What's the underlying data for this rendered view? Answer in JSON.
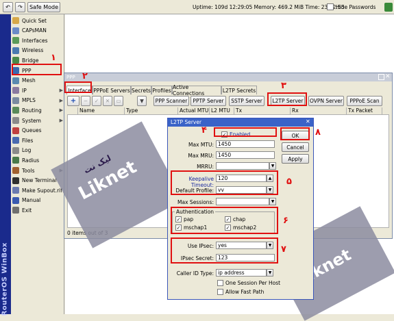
{
  "topbar": {
    "undo": "↶",
    "redo": "↷",
    "safe_mode": "Safe Mode",
    "uptime_label": "Uptime:",
    "uptime_value": "109d 12:29:05",
    "memory_label": "Memory:",
    "memory_value": "469.2 MiB",
    "time_label": "Time:",
    "time_value": "23:12:55",
    "hide_passwords": "Hide Passwords"
  },
  "vertical_brand": "RouterOS WinBox",
  "sidebar": {
    "items": [
      {
        "label": "Quick Set",
        "color": "#d6a84a"
      },
      {
        "label": "CAPsMAN",
        "color": "#6a8ac8"
      },
      {
        "label": "Interfaces",
        "color": "#5a9a5a"
      },
      {
        "label": "Wireless",
        "color": "#4a7ab0"
      },
      {
        "label": "Bridge",
        "color": "#4a8a4a"
      },
      {
        "label": "PPP",
        "color": "#3a6ab0"
      },
      {
        "label": "Mesh",
        "color": "#5a8ab0"
      },
      {
        "label": "IP",
        "color": "#8a7aa0",
        "arrow": "▶"
      },
      {
        "label": "MPLS",
        "color": "#7a8aa0",
        "arrow": "▶"
      },
      {
        "label": "Routing",
        "color": "#5a8a5a",
        "arrow": "▶"
      },
      {
        "label": "System",
        "color": "#8a8a8a",
        "arrow": "▶"
      },
      {
        "label": "Queues",
        "color": "#c04040"
      },
      {
        "label": "Files",
        "color": "#4a6ab0"
      },
      {
        "label": "Log",
        "color": "#8a8a8a"
      },
      {
        "label": "Radius",
        "color": "#4a7a4a"
      },
      {
        "label": "Tools",
        "color": "#a06030",
        "arrow": "▶"
      },
      {
        "label": "New Terminal",
        "color": "#303030"
      },
      {
        "label": "Make Supout.rif",
        "color": "#6a7ab0"
      },
      {
        "label": "Manual",
        "color": "#3a5ab0"
      },
      {
        "label": "Exit",
        "color": "#707070"
      }
    ]
  },
  "ppp_window": {
    "title": "PPP",
    "tabs": [
      "Interface",
      "PPPoE Servers",
      "Secrets",
      "Profiles",
      "Active Connections",
      "L2TP Secrets"
    ],
    "toolbar_buttons": [
      "PPP Scanner",
      "PPTP Server",
      "SSTP Server",
      "L2TP Server",
      "OVPN Server",
      "PPPoE Scan"
    ],
    "columns": [
      "Name",
      "Type",
      "Actual MTU",
      "L2 MTU",
      "Tx",
      "Rx",
      "Tx Packet (p/s)"
    ],
    "status": "0 items out of 3"
  },
  "l2tp_dialog": {
    "title": "L2TP Server",
    "enabled_label": "Enabled",
    "max_mtu_label": "Max MTU:",
    "max_mtu": "1450",
    "max_mru_label": "Max MRU:",
    "max_mru": "1450",
    "mrru_label": "MRRU:",
    "keepalive_label": "Keepalive Timeout:",
    "keepalive": "120",
    "default_profile_label": "Default Profile:",
    "default_profile": "vv",
    "max_sessions_label": "Max Sessions:",
    "auth_title": "Authentication",
    "auth": {
      "pap": "pap",
      "chap": "chap",
      "mschap1": "mschap1",
      "mschap2": "mschap2"
    },
    "use_ipsec_label": "Use IPsec:",
    "use_ipsec": "yes",
    "ipsec_secret_label": "IPsec Secret:",
    "ipsec_secret": "123",
    "caller_id_label": "Caller ID Type:",
    "caller_id": "ip address",
    "one_session": "One Session Per Host",
    "allow_fast_path": "Allow Fast Path",
    "buttons": {
      "ok": "OK",
      "cancel": "Cancel",
      "apply": "Apply"
    }
  },
  "annotations": [
    "۱",
    "۲",
    "۳",
    "۴",
    "۵",
    "۶",
    "۷",
    "۸"
  ],
  "watermark": {
    "brand": "Liknet",
    "arabic": "لیک نت"
  },
  "colors": {
    "highlight": "#e01010",
    "title_blue": "#3a63c8",
    "sidebar_strip": "#1a2a8c"
  }
}
